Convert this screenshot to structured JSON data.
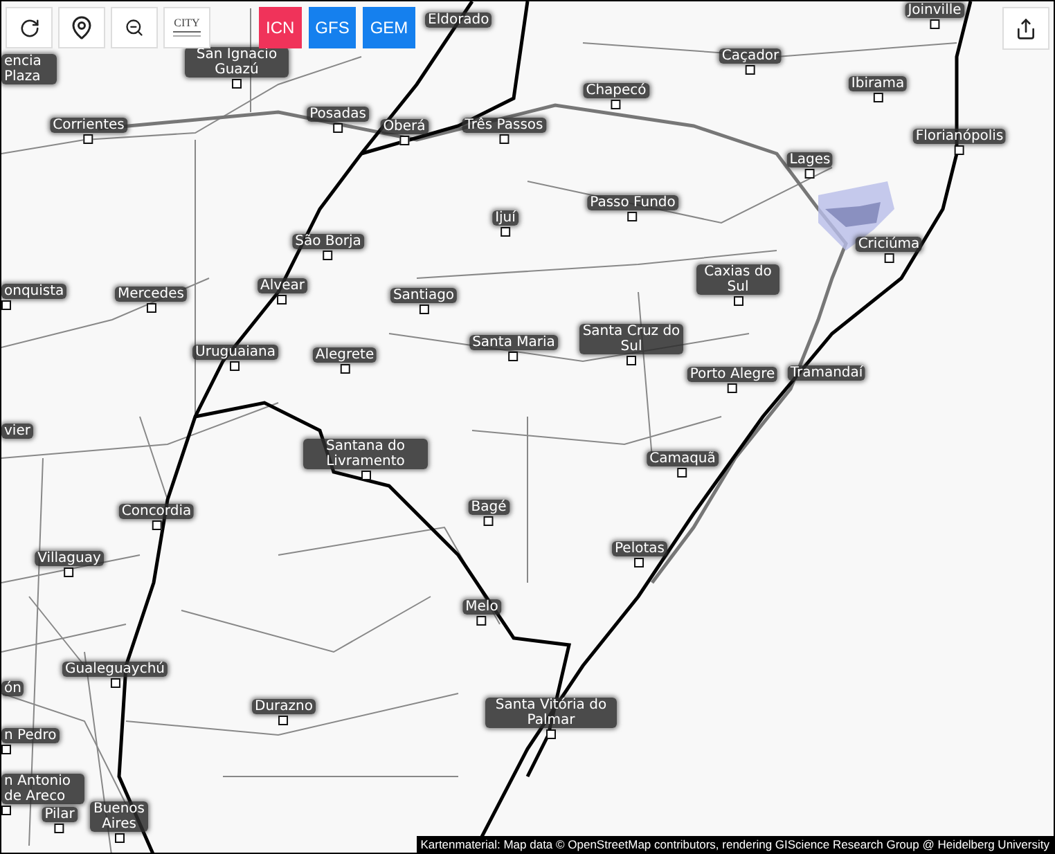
{
  "toolbar": {
    "city_button": {
      "label": "CITY"
    }
  },
  "models": [
    {
      "label": "ICN",
      "selected": true
    },
    {
      "label": "GFS",
      "selected": false
    },
    {
      "label": "GEM",
      "selected": false
    }
  ],
  "map": {
    "cities": [
      "Joinville",
      "Eldorado",
      "encia Plaza",
      "San Ignacio Guazú",
      "Caçador",
      "Chapecó",
      "Ibirama",
      "Corrientes",
      "Posadas",
      "Oberá",
      "Três Passos",
      "Florianópolis",
      "Lages",
      "São Borja",
      "Ijuí",
      "Passo Fundo",
      "Criciúma",
      "onquista",
      "Mercedes",
      "Alvear",
      "Santiago",
      "Caxias do Sul",
      "Uruguaiana",
      "Alegrete",
      "Santa Maria",
      "Santa Cruz do Sul",
      "Porto Alegre",
      "Tramandaí",
      "vier",
      "Santana do Livramento",
      "Camaquã",
      "Concordia",
      "Bagé",
      "Villaguay",
      "Pelotas",
      "Melo",
      "Gualeguaychú",
      "ón",
      "Durazno",
      "Santa Vitória do Palmar",
      "n Pedro",
      "n Antonio de Areco",
      "Pilar",
      "Buenos Aires"
    ],
    "attribution": "Kartenmaterial: Map data © OpenStreetMap contributors, rendering GIScience Research Group @ Heidelberg University"
  }
}
